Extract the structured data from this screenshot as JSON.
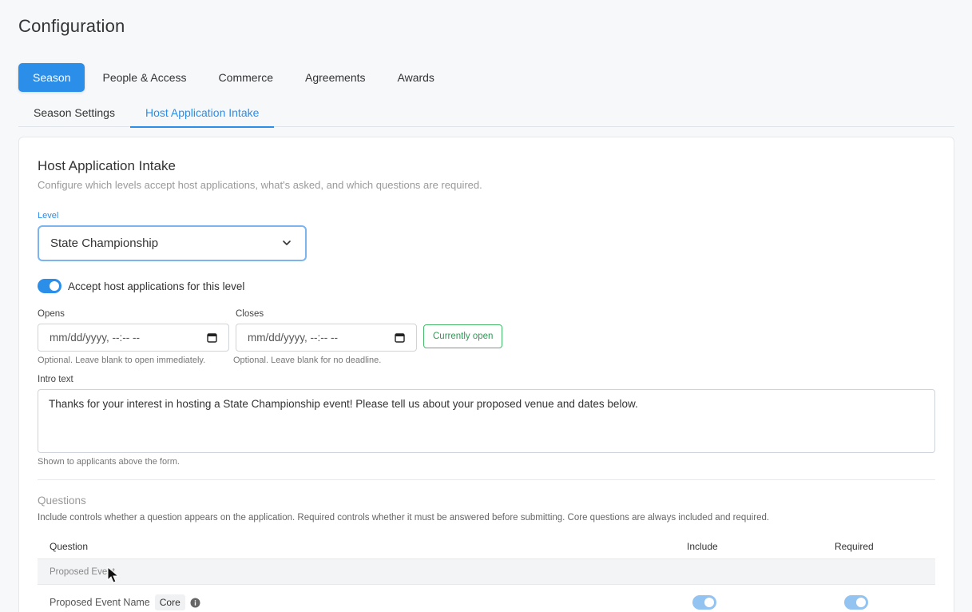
{
  "page": {
    "title": "Configuration"
  },
  "main_tabs": [
    {
      "label": "Season",
      "active": true
    },
    {
      "label": "People & Access",
      "active": false
    },
    {
      "label": "Commerce",
      "active": false
    },
    {
      "label": "Agreements",
      "active": false
    },
    {
      "label": "Awards",
      "active": false
    }
  ],
  "sub_tabs": [
    {
      "label": "Season Settings",
      "active": false
    },
    {
      "label": "Host Application Intake",
      "active": true
    }
  ],
  "card": {
    "title": "Host Application Intake",
    "description": "Configure which levels accept host applications, what's asked, and which questions are required."
  },
  "level": {
    "label": "Level",
    "value": "State Championship"
  },
  "accept": {
    "label": "Accept host applications for this level",
    "enabled": true
  },
  "opens": {
    "label": "Opens",
    "placeholder": "mm/dd/yyyy, --:-- --",
    "hint": "Optional. Leave blank to open immediately."
  },
  "closes": {
    "label": "Closes",
    "placeholder": "mm/dd/yyyy, --:-- --",
    "hint": "Optional. Leave blank for no deadline."
  },
  "status": {
    "label": "Currently open"
  },
  "intro": {
    "label": "Intro text",
    "value": "Thanks for your interest in hosting a State Championship event! Please tell us about your proposed venue and dates below.",
    "hint": "Shown to applicants above the form."
  },
  "questions": {
    "title": "Questions",
    "description": "Include controls whether a question appears on the application. Required controls whether it must be answered before submitting. Core questions are always included and required.",
    "columns": {
      "question": "Question",
      "include": "Include",
      "required": "Required"
    },
    "group": "Proposed Event",
    "rows": [
      {
        "name": "Proposed Event Name",
        "badge": "Core",
        "include": true,
        "required": true
      }
    ]
  },
  "colors": {
    "accent": "#2b8ee9",
    "success": "#46b96a"
  }
}
